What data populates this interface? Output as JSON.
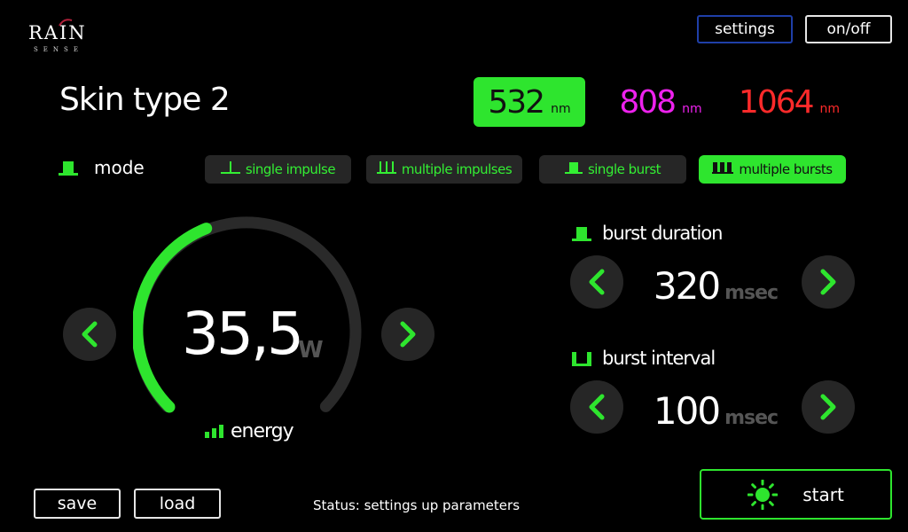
{
  "brand": {
    "name": "RAIN",
    "sub": "SENSE"
  },
  "top_buttons": {
    "settings": "settings",
    "onoff": "on/off"
  },
  "title": "Skin type 2",
  "wavelengths": [
    {
      "value": "532",
      "unit": "nm",
      "selected": true,
      "color": "#2ee52e"
    },
    {
      "value": "808",
      "unit": "nm",
      "selected": false,
      "color": "#ee22ee"
    },
    {
      "value": "1064",
      "unit": "nm",
      "selected": false,
      "color": "#ff2a2a"
    }
  ],
  "mode": {
    "label": "mode",
    "options": [
      {
        "label": "single impulse",
        "icon": "single-impulse-icon",
        "selected": false
      },
      {
        "label": "multiple impulses",
        "icon": "multiple-impulses-icon",
        "selected": false
      },
      {
        "label": "single burst",
        "icon": "single-burst-icon",
        "selected": false
      },
      {
        "label": "multiple bursts",
        "icon": "multiple-bursts-icon",
        "selected": true
      }
    ]
  },
  "power": {
    "value": "35,5",
    "unit": "W",
    "level_fraction": 0.42,
    "label": "energy"
  },
  "burst_duration": {
    "label": "burst duration",
    "value": "320",
    "unit": "msec"
  },
  "burst_interval": {
    "label": "burst interval",
    "value": "100",
    "unit": "msec"
  },
  "bottom": {
    "save": "save",
    "load": "load",
    "status": "Status: settings up parameters",
    "start": "start"
  },
  "colors": {
    "accent": "#2ee52e",
    "panel": "#262626",
    "settings_border": "#1f3fa8"
  }
}
